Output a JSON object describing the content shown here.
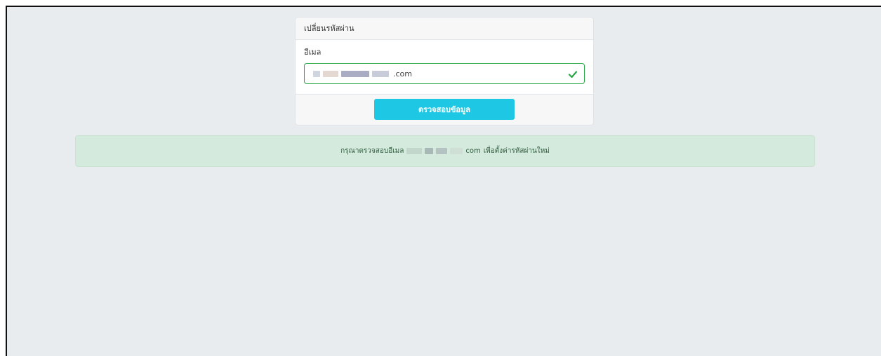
{
  "card": {
    "title": "เปลี่ยนรหัสผ่าน",
    "email_label": "อีเมล",
    "email_value_suffix": ".com",
    "email_valid_icon": "check-icon",
    "verify_button": "ตรวจสอบข้อมูล"
  },
  "alert": {
    "prefix": "กรุณาตรวจสอบอีเมล",
    "email_suffix": "com",
    "suffix": "เพื่อตั้งค่ารหัสผ่านใหม่"
  },
  "colors": {
    "valid_border": "#28a745",
    "button": "#1ec8e4",
    "alert_bg": "#d4eadd",
    "page_bg": "#e9ecef"
  }
}
